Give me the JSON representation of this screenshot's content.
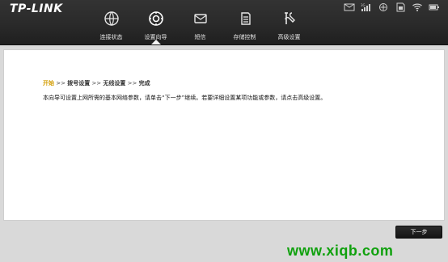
{
  "app": {
    "brand": "TP-LINK"
  },
  "status_icons": [
    {
      "icon": "mail-icon"
    },
    {
      "icon": "signal-strength-icon"
    },
    {
      "icon": "network-icon"
    },
    {
      "icon": "sim-card-icon"
    },
    {
      "icon": "wifi-icon"
    },
    {
      "icon": "battery-icon"
    }
  ],
  "nav": {
    "items": [
      {
        "label": "连接状态",
        "icon": "globe-icon",
        "active": false
      },
      {
        "label": "设置向导",
        "icon": "settings-icon",
        "active": true
      },
      {
        "label": "短信",
        "icon": "message-icon",
        "active": false
      },
      {
        "label": "存储控制",
        "icon": "storage-icon",
        "active": false
      },
      {
        "label": "高级设置",
        "icon": "tools-icon",
        "active": false
      }
    ]
  },
  "wizard": {
    "steps": {
      "start": "开始",
      "dial": "拨号设置",
      "wireless": "无线设置",
      "finish": "完成",
      "sep": ">>"
    },
    "description": "本向导可设置上网所需的基本网络参数，请单击“下一步”继续。若要详细设置某项功能或参数，请点击高级设置。"
  },
  "buttons": {
    "next": "下一步"
  },
  "watermark": {
    "text": "www.xiqb.com"
  },
  "colors": {
    "header_bg": "#2a2a2a",
    "active_step": "#d29c00",
    "watermark": "#10a10e"
  }
}
